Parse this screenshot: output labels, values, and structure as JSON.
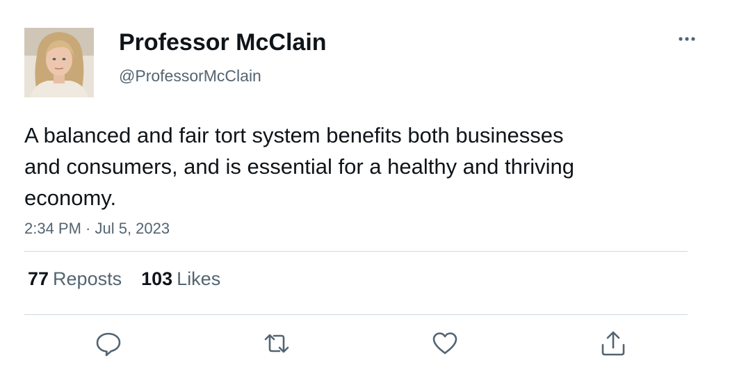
{
  "author": {
    "display_name": "Professor McClain",
    "handle": "@ProfessorMcClain",
    "avatar_icon": "profile-photo"
  },
  "tweet": {
    "text": "A balanced and fair tort system benefits both businesses and consumers, and is essential for a healthy and thriving economy.",
    "timestamp": "2:34 PM · Jul 5, 2023"
  },
  "stats": {
    "reposts_count": "77",
    "reposts_label": "Reposts",
    "likes_count": "103",
    "likes_label": "Likes"
  },
  "actions": {
    "more_icon": "more-horizontal-icon",
    "reply_icon": "reply-icon",
    "repost_icon": "repost-icon",
    "like_icon": "heart-icon",
    "share_icon": "share-icon"
  },
  "colors": {
    "text_primary": "#0f1419",
    "text_secondary": "#536471",
    "divider": "#cfd9de"
  }
}
